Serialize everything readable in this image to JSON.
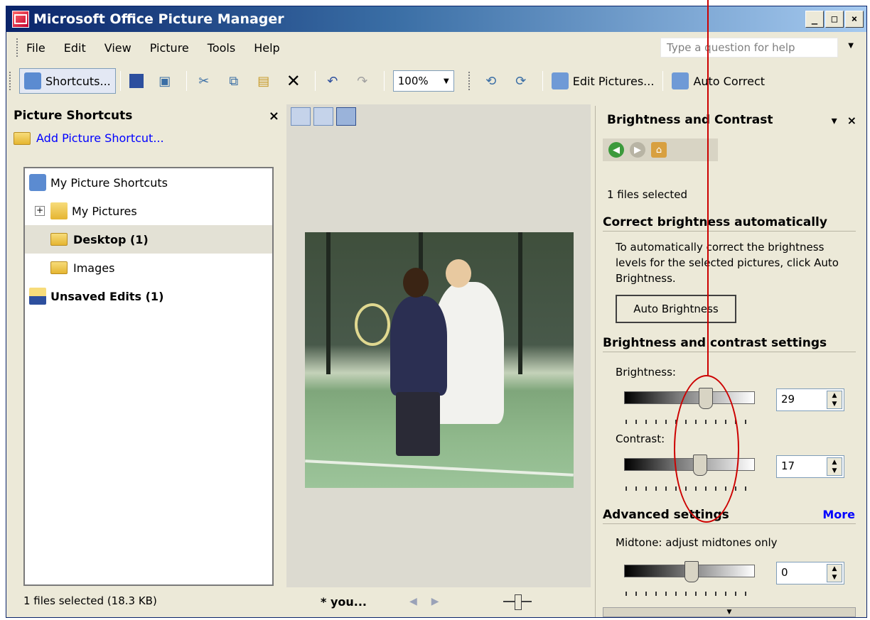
{
  "window": {
    "title": "Microsoft Office Picture Manager",
    "buttons": {
      "minimize": "_",
      "maximize": "□",
      "close": "×"
    }
  },
  "menubar": {
    "items": [
      "File",
      "Edit",
      "View",
      "Picture",
      "Tools",
      "Help"
    ],
    "help_placeholder": "Type a question for help"
  },
  "toolbar": {
    "shortcuts_label": "Shortcuts...",
    "zoom_value": "100%",
    "edit_pictures_label": "Edit Pictures...",
    "auto_correct_label": "Auto Correct"
  },
  "left_panel": {
    "title": "Picture Shortcuts",
    "add_link": "Add Picture Shortcut...",
    "tree": [
      {
        "label": "My Picture Shortcuts",
        "bold": false,
        "selected": false
      },
      {
        "label": "My Pictures",
        "bold": false,
        "selected": false,
        "expander": "+"
      },
      {
        "label": "Desktop (1)",
        "bold": true,
        "selected": true
      },
      {
        "label": "Images",
        "bold": false,
        "selected": false
      },
      {
        "label": "Unsaved Edits (1)",
        "bold": true,
        "selected": false
      }
    ],
    "status": "1 files selected (18.3 KB)"
  },
  "center": {
    "filename": "* you..."
  },
  "task_pane": {
    "title": "Brightness and Contrast",
    "files_selected": "1 files selected",
    "section_auto": "Correct brightness automatically",
    "auto_desc": "To automatically correct the brightness levels for the selected pictures, click Auto Brightness.",
    "auto_button": "Auto Brightness",
    "section_settings": "Brightness and contrast settings",
    "brightness_label": "Brightness:",
    "brightness_value": "29",
    "contrast_label": "Contrast:",
    "contrast_value": "17",
    "section_advanced": "Advanced settings",
    "more_link": "More",
    "midtone_label": "Midtone: adjust midtones only",
    "midtone_value": "0"
  },
  "colors": {
    "annotation": "#cc0000",
    "title_bar_start": "#0a246a",
    "link": "#0000ff"
  }
}
